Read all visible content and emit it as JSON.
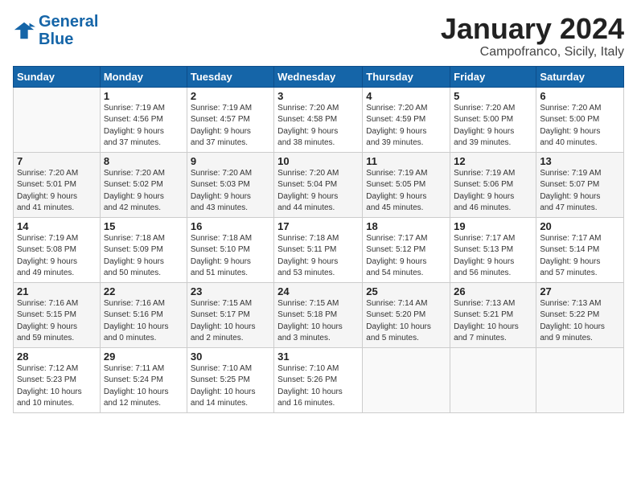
{
  "header": {
    "logo_line1": "General",
    "logo_line2": "Blue",
    "month": "January 2024",
    "location": "Campofranco, Sicily, Italy"
  },
  "weekdays": [
    "Sunday",
    "Monday",
    "Tuesday",
    "Wednesday",
    "Thursday",
    "Friday",
    "Saturday"
  ],
  "weeks": [
    [
      {
        "day": "",
        "info": ""
      },
      {
        "day": "1",
        "info": "Sunrise: 7:19 AM\nSunset: 4:56 PM\nDaylight: 9 hours\nand 37 minutes."
      },
      {
        "day": "2",
        "info": "Sunrise: 7:19 AM\nSunset: 4:57 PM\nDaylight: 9 hours\nand 37 minutes."
      },
      {
        "day": "3",
        "info": "Sunrise: 7:20 AM\nSunset: 4:58 PM\nDaylight: 9 hours\nand 38 minutes."
      },
      {
        "day": "4",
        "info": "Sunrise: 7:20 AM\nSunset: 4:59 PM\nDaylight: 9 hours\nand 39 minutes."
      },
      {
        "day": "5",
        "info": "Sunrise: 7:20 AM\nSunset: 5:00 PM\nDaylight: 9 hours\nand 39 minutes."
      },
      {
        "day": "6",
        "info": "Sunrise: 7:20 AM\nSunset: 5:00 PM\nDaylight: 9 hours\nand 40 minutes."
      }
    ],
    [
      {
        "day": "7",
        "info": "Sunrise: 7:20 AM\nSunset: 5:01 PM\nDaylight: 9 hours\nand 41 minutes."
      },
      {
        "day": "8",
        "info": "Sunrise: 7:20 AM\nSunset: 5:02 PM\nDaylight: 9 hours\nand 42 minutes."
      },
      {
        "day": "9",
        "info": "Sunrise: 7:20 AM\nSunset: 5:03 PM\nDaylight: 9 hours\nand 43 minutes."
      },
      {
        "day": "10",
        "info": "Sunrise: 7:20 AM\nSunset: 5:04 PM\nDaylight: 9 hours\nand 44 minutes."
      },
      {
        "day": "11",
        "info": "Sunrise: 7:19 AM\nSunset: 5:05 PM\nDaylight: 9 hours\nand 45 minutes."
      },
      {
        "day": "12",
        "info": "Sunrise: 7:19 AM\nSunset: 5:06 PM\nDaylight: 9 hours\nand 46 minutes."
      },
      {
        "day": "13",
        "info": "Sunrise: 7:19 AM\nSunset: 5:07 PM\nDaylight: 9 hours\nand 47 minutes."
      }
    ],
    [
      {
        "day": "14",
        "info": "Sunrise: 7:19 AM\nSunset: 5:08 PM\nDaylight: 9 hours\nand 49 minutes."
      },
      {
        "day": "15",
        "info": "Sunrise: 7:18 AM\nSunset: 5:09 PM\nDaylight: 9 hours\nand 50 minutes."
      },
      {
        "day": "16",
        "info": "Sunrise: 7:18 AM\nSunset: 5:10 PM\nDaylight: 9 hours\nand 51 minutes."
      },
      {
        "day": "17",
        "info": "Sunrise: 7:18 AM\nSunset: 5:11 PM\nDaylight: 9 hours\nand 53 minutes."
      },
      {
        "day": "18",
        "info": "Sunrise: 7:17 AM\nSunset: 5:12 PM\nDaylight: 9 hours\nand 54 minutes."
      },
      {
        "day": "19",
        "info": "Sunrise: 7:17 AM\nSunset: 5:13 PM\nDaylight: 9 hours\nand 56 minutes."
      },
      {
        "day": "20",
        "info": "Sunrise: 7:17 AM\nSunset: 5:14 PM\nDaylight: 9 hours\nand 57 minutes."
      }
    ],
    [
      {
        "day": "21",
        "info": "Sunrise: 7:16 AM\nSunset: 5:15 PM\nDaylight: 9 hours\nand 59 minutes."
      },
      {
        "day": "22",
        "info": "Sunrise: 7:16 AM\nSunset: 5:16 PM\nDaylight: 10 hours\nand 0 minutes."
      },
      {
        "day": "23",
        "info": "Sunrise: 7:15 AM\nSunset: 5:17 PM\nDaylight: 10 hours\nand 2 minutes."
      },
      {
        "day": "24",
        "info": "Sunrise: 7:15 AM\nSunset: 5:18 PM\nDaylight: 10 hours\nand 3 minutes."
      },
      {
        "day": "25",
        "info": "Sunrise: 7:14 AM\nSunset: 5:20 PM\nDaylight: 10 hours\nand 5 minutes."
      },
      {
        "day": "26",
        "info": "Sunrise: 7:13 AM\nSunset: 5:21 PM\nDaylight: 10 hours\nand 7 minutes."
      },
      {
        "day": "27",
        "info": "Sunrise: 7:13 AM\nSunset: 5:22 PM\nDaylight: 10 hours\nand 9 minutes."
      }
    ],
    [
      {
        "day": "28",
        "info": "Sunrise: 7:12 AM\nSunset: 5:23 PM\nDaylight: 10 hours\nand 10 minutes."
      },
      {
        "day": "29",
        "info": "Sunrise: 7:11 AM\nSunset: 5:24 PM\nDaylight: 10 hours\nand 12 minutes."
      },
      {
        "day": "30",
        "info": "Sunrise: 7:10 AM\nSunset: 5:25 PM\nDaylight: 10 hours\nand 14 minutes."
      },
      {
        "day": "31",
        "info": "Sunrise: 7:10 AM\nSunset: 5:26 PM\nDaylight: 10 hours\nand 16 minutes."
      },
      {
        "day": "",
        "info": ""
      },
      {
        "day": "",
        "info": ""
      },
      {
        "day": "",
        "info": ""
      }
    ]
  ]
}
